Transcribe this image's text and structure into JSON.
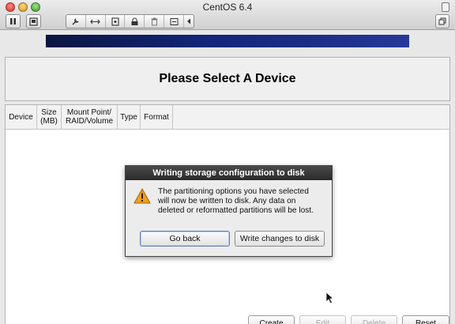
{
  "window": {
    "title": "CentOS 6.4"
  },
  "installer": {
    "page_title": "Please Select A Device",
    "columns": [
      "Device",
      "Size\n(MB)",
      "Mount Point/\nRAID/Volume",
      "Type",
      "Format"
    ],
    "buttons": {
      "create": "Create",
      "edit": "Edit",
      "delete": "Delete",
      "reset": "Reset"
    }
  },
  "dialog": {
    "title": "Writing storage configuration to disk",
    "message": "The partitioning options you have selected\nwill now be written to disk.  Any data on\ndeleted or reformatted partitions will be lost.",
    "go_back_label": "Go back",
    "write_label": "Write changes to disk"
  },
  "colors": {
    "progress_bar": "#13267a",
    "dialog_titlebar": "#2a2a2a",
    "warning_icon": "#f0a020"
  },
  "icons": {
    "toolbar": [
      "pause-icon",
      "snapshot-icon",
      "wrench-icon",
      "network-arrows-icon",
      "disk-icon",
      "lock-icon",
      "trash-icon",
      "settings-icon",
      "collapse-arrow-icon"
    ],
    "dialog": "warning-icon"
  }
}
